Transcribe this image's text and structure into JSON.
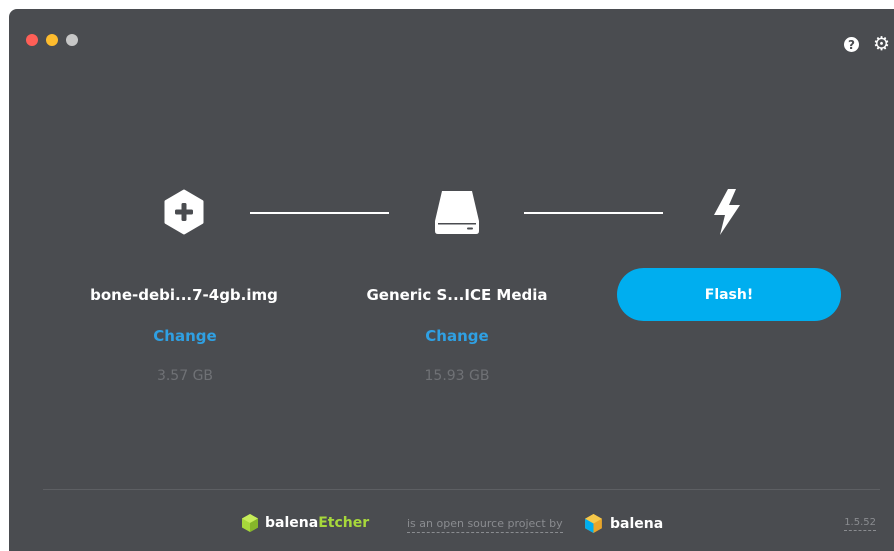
{
  "window": {
    "controls": [
      "close",
      "minimize",
      "maximize"
    ],
    "help_icon": "question-circle-icon",
    "settings_icon": "gear-icon"
  },
  "steps": {
    "image": {
      "icon": "plus-hexagon-icon",
      "name": "bone-debi...7-4gb.img",
      "change_label": "Change",
      "size": "3.57 GB"
    },
    "drive": {
      "icon": "drive-icon",
      "name": "Generic S...ICE Media",
      "change_label": "Change",
      "size": "15.93 GB"
    },
    "flash": {
      "icon": "lightning-icon",
      "button_label": "Flash!"
    }
  },
  "footer": {
    "brand_prefix": "balena",
    "brand_suffix": "Etcher",
    "tagline": "is an open source project by",
    "company": "balena",
    "version": "1.5.52"
  },
  "colors": {
    "background": "#4a4c50",
    "accent": "#00aeef",
    "link": "#2fa0e3",
    "brand_green": "#a7d83b"
  }
}
